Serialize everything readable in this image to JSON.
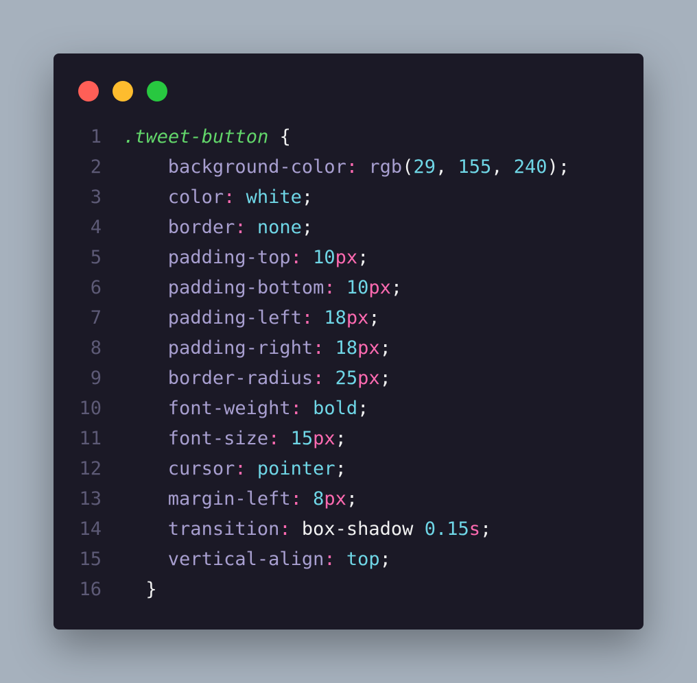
{
  "window": {
    "controls": {
      "close_color": "#ff5f57",
      "minimize_color": "#febc2e",
      "maximize_color": "#28c840"
    }
  },
  "code_lines": [
    {
      "n": "1",
      "indent": 0,
      "tokens": [
        {
          "t": ".tweet-button",
          "c": "selector"
        },
        {
          "t": " {",
          "c": "punc"
        }
      ]
    },
    {
      "n": "2",
      "indent": 2,
      "tokens": [
        {
          "t": "background-color",
          "c": "prop"
        },
        {
          "t": ": ",
          "c": "colon"
        },
        {
          "t": "rgb",
          "c": "fn"
        },
        {
          "t": "(",
          "c": "punc"
        },
        {
          "t": "29",
          "c": "num"
        },
        {
          "t": ", ",
          "c": "punc"
        },
        {
          "t": "155",
          "c": "num"
        },
        {
          "t": ", ",
          "c": "punc"
        },
        {
          "t": "240",
          "c": "num"
        },
        {
          "t": ");",
          "c": "punc"
        }
      ]
    },
    {
      "n": "3",
      "indent": 2,
      "tokens": [
        {
          "t": "color",
          "c": "prop"
        },
        {
          "t": ": ",
          "c": "colon"
        },
        {
          "t": "white",
          "c": "kw"
        },
        {
          "t": ";",
          "c": "punc"
        }
      ]
    },
    {
      "n": "4",
      "indent": 2,
      "tokens": [
        {
          "t": "border",
          "c": "prop"
        },
        {
          "t": ": ",
          "c": "colon"
        },
        {
          "t": "none",
          "c": "kw"
        },
        {
          "t": ";",
          "c": "punc"
        }
      ]
    },
    {
      "n": "5",
      "indent": 2,
      "tokens": [
        {
          "t": "padding-top",
          "c": "prop"
        },
        {
          "t": ": ",
          "c": "colon"
        },
        {
          "t": "10",
          "c": "num"
        },
        {
          "t": "px",
          "c": "unit"
        },
        {
          "t": ";",
          "c": "punc"
        }
      ]
    },
    {
      "n": "6",
      "indent": 2,
      "tokens": [
        {
          "t": "padding-bottom",
          "c": "prop"
        },
        {
          "t": ": ",
          "c": "colon"
        },
        {
          "t": "10",
          "c": "num"
        },
        {
          "t": "px",
          "c": "unit"
        },
        {
          "t": ";",
          "c": "punc"
        }
      ]
    },
    {
      "n": "7",
      "indent": 2,
      "tokens": [
        {
          "t": "padding-left",
          "c": "prop"
        },
        {
          "t": ": ",
          "c": "colon"
        },
        {
          "t": "18",
          "c": "num"
        },
        {
          "t": "px",
          "c": "unit"
        },
        {
          "t": ";",
          "c": "punc"
        }
      ]
    },
    {
      "n": "8",
      "indent": 2,
      "tokens": [
        {
          "t": "padding-right",
          "c": "prop"
        },
        {
          "t": ": ",
          "c": "colon"
        },
        {
          "t": "18",
          "c": "num"
        },
        {
          "t": "px",
          "c": "unit"
        },
        {
          "t": ";",
          "c": "punc"
        }
      ]
    },
    {
      "n": "9",
      "indent": 2,
      "tokens": [
        {
          "t": "border-radius",
          "c": "prop"
        },
        {
          "t": ": ",
          "c": "colon"
        },
        {
          "t": "25",
          "c": "num"
        },
        {
          "t": "px",
          "c": "unit"
        },
        {
          "t": ";",
          "c": "punc"
        }
      ]
    },
    {
      "n": "10",
      "indent": 2,
      "tokens": [
        {
          "t": "font-weight",
          "c": "prop"
        },
        {
          "t": ": ",
          "c": "colon"
        },
        {
          "t": "bold",
          "c": "kw"
        },
        {
          "t": ";",
          "c": "punc"
        }
      ]
    },
    {
      "n": "11",
      "indent": 2,
      "tokens": [
        {
          "t": "font-size",
          "c": "prop"
        },
        {
          "t": ": ",
          "c": "colon"
        },
        {
          "t": "15",
          "c": "num"
        },
        {
          "t": "px",
          "c": "unit"
        },
        {
          "t": ";",
          "c": "punc"
        }
      ]
    },
    {
      "n": "12",
      "indent": 2,
      "tokens": [
        {
          "t": "cursor",
          "c": "prop"
        },
        {
          "t": ": ",
          "c": "colon"
        },
        {
          "t": "pointer",
          "c": "kw"
        },
        {
          "t": ";",
          "c": "punc"
        }
      ]
    },
    {
      "n": "13",
      "indent": 2,
      "tokens": [
        {
          "t": "margin-left",
          "c": "prop"
        },
        {
          "t": ": ",
          "c": "colon"
        },
        {
          "t": "8",
          "c": "num"
        },
        {
          "t": "px",
          "c": "unit"
        },
        {
          "t": ";",
          "c": "punc"
        }
      ]
    },
    {
      "n": "14",
      "indent": 2,
      "tokens": [
        {
          "t": "transition",
          "c": "prop"
        },
        {
          "t": ": ",
          "c": "colon"
        },
        {
          "t": "box-shadow ",
          "c": "plain"
        },
        {
          "t": "0.15",
          "c": "num"
        },
        {
          "t": "s",
          "c": "unit"
        },
        {
          "t": ";",
          "c": "punc"
        }
      ]
    },
    {
      "n": "15",
      "indent": 2,
      "tokens": [
        {
          "t": "vertical-align",
          "c": "prop"
        },
        {
          "t": ": ",
          "c": "colon"
        },
        {
          "t": "top",
          "c": "kw"
        },
        {
          "t": ";",
          "c": "punc"
        }
      ]
    },
    {
      "n": "16",
      "indent": 1,
      "tokens": [
        {
          "t": "}",
          "c": "punc"
        }
      ]
    }
  ]
}
